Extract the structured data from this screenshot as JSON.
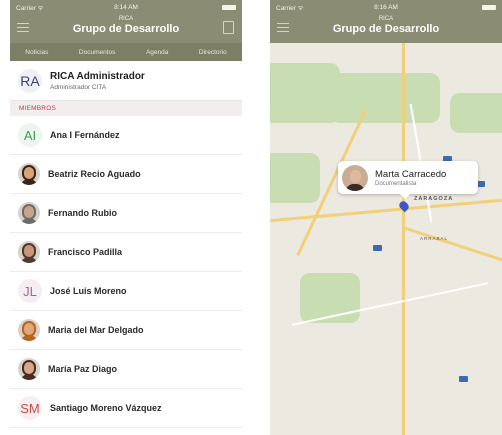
{
  "left": {
    "status": {
      "carrier": "Carrier ᯤ",
      "time": "8:14 AM"
    },
    "nav": {
      "subtitle": "RICA",
      "title": "Grupo de Desarrollo"
    },
    "tabs": [
      "Noticias",
      "Documentos",
      "Agenda",
      "Directorio"
    ],
    "admin": {
      "initials": "RA",
      "name": "RICA Administrador",
      "role": "Administrador CITA"
    },
    "section": "MIEMBROS",
    "members": [
      {
        "name": "Ana I Fernández",
        "initials": "AI",
        "color": "#3a9a5c",
        "bg": "#eef5ef"
      },
      {
        "name": "Beatriz Recio Aguado",
        "face": "#d9a27a",
        "hair": "#3a2317"
      },
      {
        "name": "Fernando Rubio",
        "face": "#c9a38a",
        "hair": "#6c6c6c"
      },
      {
        "name": "Francisco Padilla",
        "face": "#c8977a",
        "hair": "#4d3a30"
      },
      {
        "name": "José Luis Moreno",
        "initials": "JL",
        "color": "#a5658a",
        "bg": "#f4eef2"
      },
      {
        "name": "Maria del Mar Delgado",
        "face": "#e2a67c",
        "hair": "#b5651d"
      },
      {
        "name": "María Paz Diago",
        "face": "#d7a889",
        "hair": "#4a2c1e"
      },
      {
        "name": "Santiago Moreno Vázquez",
        "initials": "SM",
        "color": "#c24b4b",
        "bg": "#f8eeee"
      }
    ]
  },
  "right": {
    "status": {
      "carrier": "Carrier ᯤ",
      "time": "8:16 AM"
    },
    "nav": {
      "subtitle": "RICA",
      "title": "Grupo de Desarrollo"
    },
    "callout": {
      "name": "Marta Carracedo",
      "role": "Documentalista"
    },
    "city": "ZARAGOZA",
    "district": "ARRABAL"
  },
  "colors": {
    "nav_bg": "#8b8c74",
    "tab_bg": "#7d7e66",
    "section_text": "#c0384b",
    "pin": "#3c56c7"
  }
}
